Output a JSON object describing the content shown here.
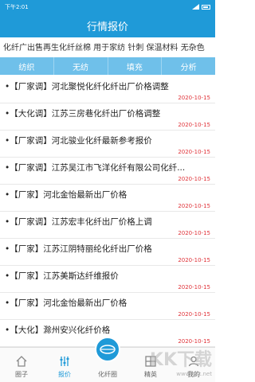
{
  "status": {
    "time": "下午2:01"
  },
  "header": {
    "title": "行情报价"
  },
  "marquee": {
    "text": "化纤广出售再生化纤丝棉 用于家纺 针刺 保温材料 无杂色"
  },
  "tabs": [
    {
      "label": "纺织"
    },
    {
      "label": "无纺"
    },
    {
      "label": "填充"
    },
    {
      "label": "分析"
    }
  ],
  "news": [
    {
      "title": "•【厂家调】河北聚悦化纤化纤出厂价格调整",
      "date": "2020-10-15"
    },
    {
      "title": "•【大化调】江苏三房巷化纤出厂价格调整",
      "date": "2020-10-15"
    },
    {
      "title": "•【厂家调】河北骏业化纤最新参考报价",
      "date": "2020-10-15"
    },
    {
      "title": "•【厂家调】江苏吴江市飞洋化纤有限公司化纤...",
      "date": "2020-10-15"
    },
    {
      "title": "•【厂家】河北金怡最新出厂价格",
      "date": "2020-10-15"
    },
    {
      "title": "•【厂家调】江苏宏丰化纤出厂价格上调",
      "date": "2020-10-15"
    },
    {
      "title": "•【厂家】江苏江阴特丽纶化纤出厂价格",
      "date": "2020-10-15"
    },
    {
      "title": "•【厂家】江苏美斯达纤维报价",
      "date": "2020-10-15"
    },
    {
      "title": "•【厂家】河北金怡最新出厂价格",
      "date": "2020-10-15"
    },
    {
      "title": "•【大化】滁州安兴化纤价格",
      "date": "2020-10-15"
    }
  ],
  "nav": [
    {
      "label": "圈子"
    },
    {
      "label": "报价"
    },
    {
      "label": "化纤圈"
    },
    {
      "label": "精英"
    },
    {
      "label": "我的"
    }
  ],
  "watermark": {
    "main": "KK下载",
    "sub": "www.kkx.net"
  },
  "colors": {
    "primary": "#1f9ad8",
    "tab_bg": "#6fc0ea",
    "date": "#e0343a"
  }
}
